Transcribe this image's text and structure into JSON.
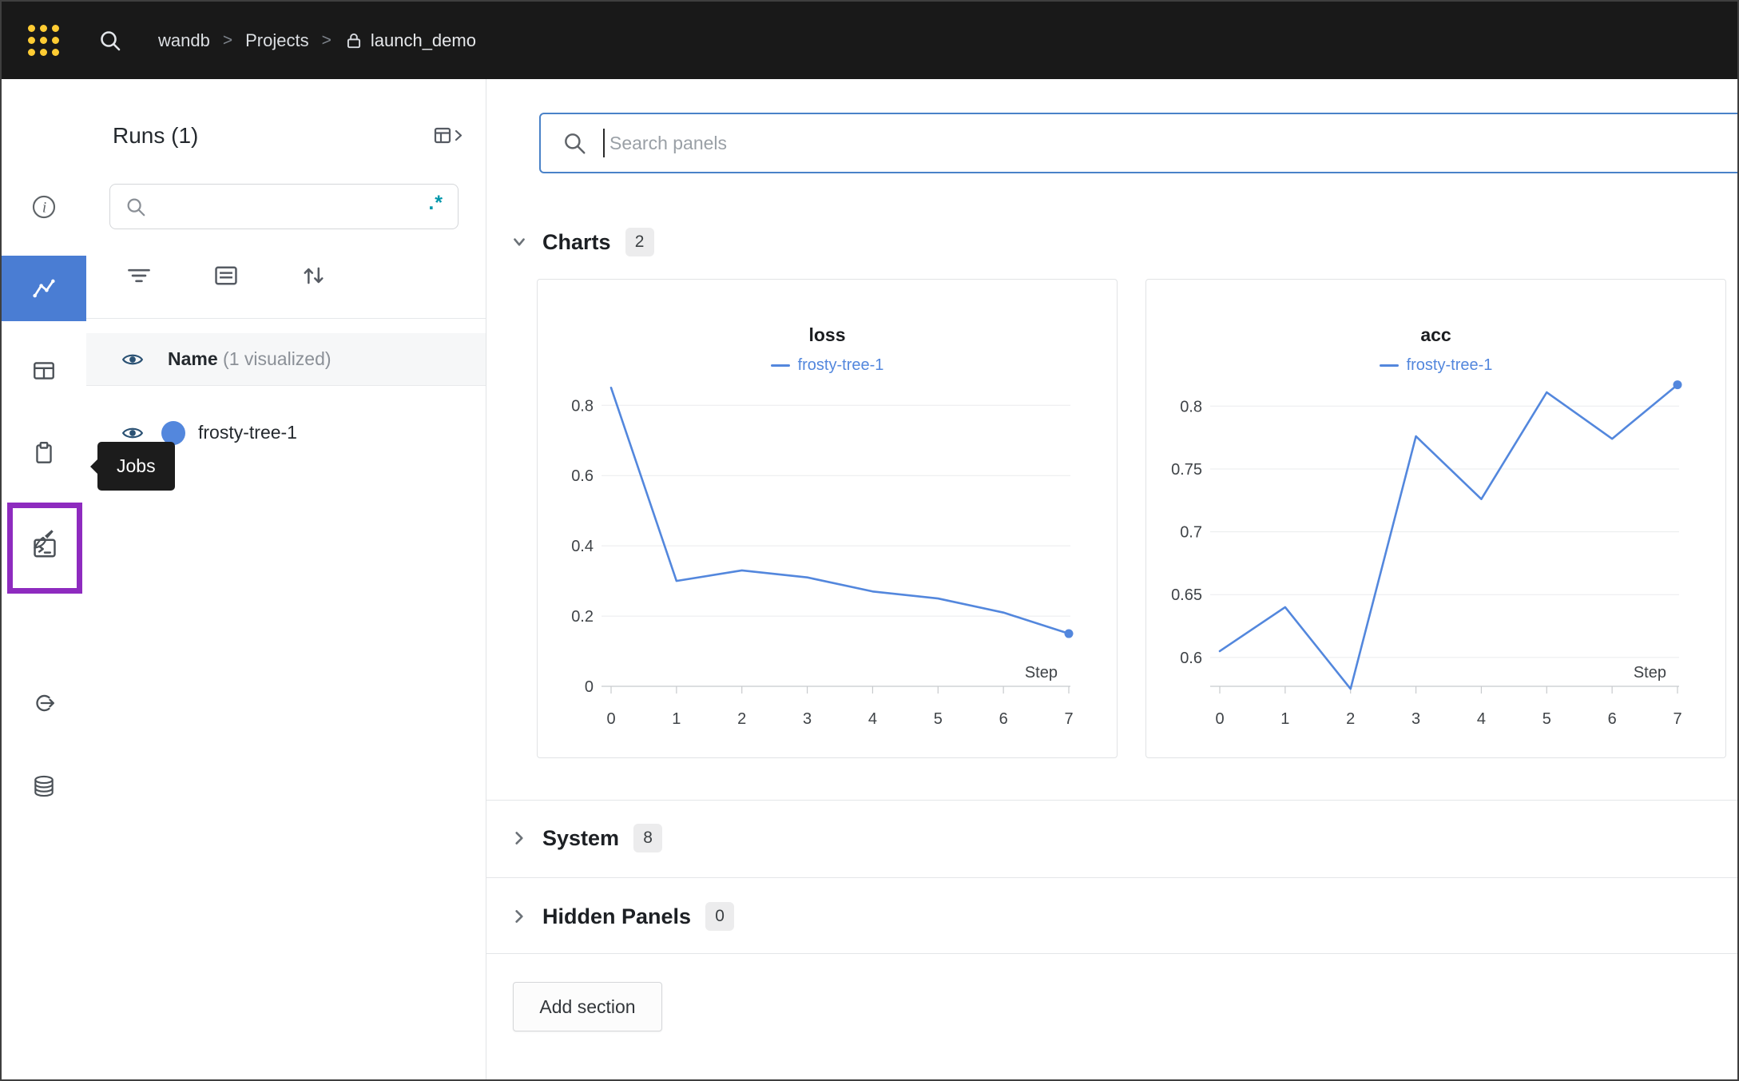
{
  "topbar": {
    "logo": "wandb-logo",
    "search_icon": "search-icon",
    "breadcrumb": {
      "org": "wandb",
      "separator": ">",
      "section": "Projects",
      "project": "launch_demo",
      "project_lock_icon": "lock-icon"
    }
  },
  "rail": {
    "items": [
      {
        "id": "overview",
        "icon": "info-icon",
        "selected": false
      },
      {
        "id": "workspace",
        "icon": "line-chart-icon",
        "selected": true
      },
      {
        "id": "table",
        "icon": "table-icon",
        "selected": false
      },
      {
        "id": "reports",
        "icon": "clipboard-icon",
        "selected": false
      },
      {
        "id": "sweeps",
        "icon": "broom-icon",
        "selected": false
      },
      {
        "id": "jobs",
        "icon": "terminal-icon",
        "selected": false,
        "highlighted": true
      },
      {
        "id": "launch",
        "icon": "launch-icon",
        "selected": false
      },
      {
        "id": "artifacts",
        "icon": "database-icon",
        "selected": false
      }
    ],
    "tooltip": "Jobs"
  },
  "runs_panel": {
    "title": "Runs (1)",
    "expand_icon": "table-expand-icon",
    "search": {
      "value": "",
      "placeholder": "",
      "regex_glyph": ".*"
    },
    "tools": [
      "filter-icon",
      "group-icon",
      "sort-icon"
    ],
    "header_row": {
      "label": "Name",
      "annotation": "(1 visualized)"
    },
    "runs": [
      {
        "name": "frosty-tree-1",
        "color": "#5387dd",
        "visible": true
      }
    ]
  },
  "main": {
    "panel_search": {
      "placeholder": "Search panels",
      "value": ""
    },
    "sections": [
      {
        "label": "Charts",
        "count": "2",
        "expanded": true
      },
      {
        "label": "System",
        "count": "8",
        "expanded": false
      },
      {
        "label": "Hidden Panels",
        "count": "0",
        "expanded": false
      }
    ],
    "add_section_label": "Add section"
  },
  "colors": {
    "accent_blue": "#5387dd",
    "selected_nav_bg": "#4a7dd3",
    "highlight_purple": "#8e2bbf",
    "regex_teal": "#0097ab",
    "logo_gold": "#ffcc33"
  },
  "chart_data": [
    {
      "type": "line",
      "title": "loss",
      "xlabel": "Step",
      "x": [
        0,
        1,
        2,
        3,
        4,
        5,
        6,
        7
      ],
      "series": [
        {
          "name": "frosty-tree-1",
          "values": [
            0.85,
            0.3,
            0.33,
            0.31,
            0.27,
            0.25,
            0.21,
            0.15
          ]
        }
      ],
      "yticks": [
        0,
        0.2,
        0.4,
        0.6,
        0.8
      ],
      "ylim": [
        0,
        0.862
      ],
      "color": "#5387dd",
      "grid": true,
      "legend_position": "top",
      "end_marker": true
    },
    {
      "type": "line",
      "title": "acc",
      "xlabel": "Step",
      "x": [
        0,
        1,
        2,
        3,
        4,
        5,
        6,
        7
      ],
      "series": [
        {
          "name": "frosty-tree-1",
          "values": [
            0.605,
            0.64,
            0.575,
            0.776,
            0.726,
            0.811,
            0.774,
            0.817
          ]
        }
      ],
      "yticks": [
        0.6,
        0.65,
        0.7,
        0.75,
        0.8
      ],
      "ylim": [
        0.577,
        0.818
      ],
      "color": "#5387dd",
      "grid": true,
      "legend_position": "top",
      "end_marker": true
    }
  ]
}
